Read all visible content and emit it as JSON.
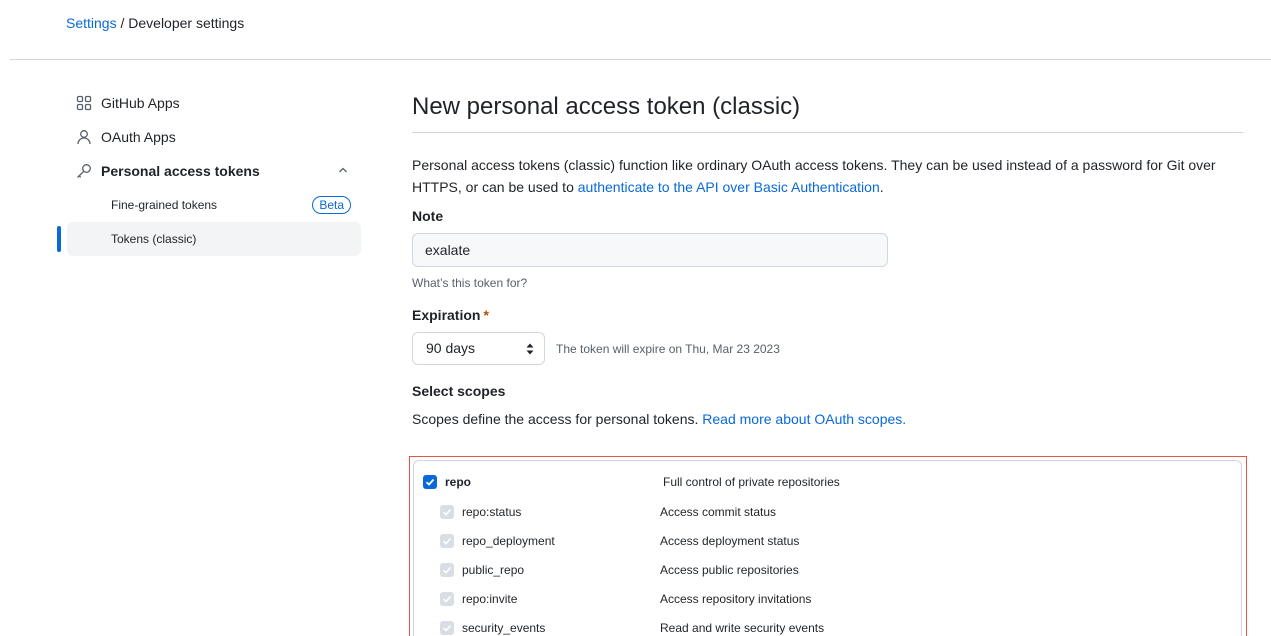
{
  "breadcrumb": {
    "settings": "Settings",
    "separator": "/",
    "current": "Developer settings"
  },
  "sidebar": {
    "items": [
      {
        "label": "GitHub Apps",
        "icon": "apps-icon"
      },
      {
        "label": "OAuth Apps",
        "icon": "person-icon"
      },
      {
        "label": "Personal access tokens",
        "icon": "key-icon",
        "expanded": true
      }
    ],
    "subitems": [
      {
        "label": "Fine-grained tokens",
        "badge": "Beta"
      },
      {
        "label": "Tokens (classic)",
        "active": true
      }
    ]
  },
  "main": {
    "title": "New personal access token (classic)",
    "description_prefix": "Personal access tokens (classic) function like ordinary OAuth access tokens. They can be used instead of a password for Git over HTTPS, or can be used to ",
    "description_link": "authenticate to the API over Basic Authentication",
    "description_suffix": ".",
    "note": {
      "label": "Note",
      "value": "exalate",
      "hint": "What’s this token for?"
    },
    "expiration": {
      "label": "Expiration",
      "required_mark": "*",
      "selected": "90 days",
      "note": "The token will expire on Thu, Mar 23 2023"
    },
    "scopes": {
      "label": "Select scopes",
      "description_prefix": "Scopes define the access for personal tokens. ",
      "description_link": "Read more about OAuth scopes.",
      "rows": [
        {
          "name": "repo",
          "desc": "Full control of private repositories",
          "parent": true
        },
        {
          "name": "repo:status",
          "desc": "Access commit status"
        },
        {
          "name": "repo_deployment",
          "desc": "Access deployment status"
        },
        {
          "name": "public_repo",
          "desc": "Access public repositories"
        },
        {
          "name": "repo:invite",
          "desc": "Access repository invitations"
        },
        {
          "name": "security_events",
          "desc": "Read and write security events"
        }
      ]
    }
  },
  "colors": {
    "accent": "#0969da",
    "highlight": "#e5534b",
    "required": "#bc4c00"
  }
}
